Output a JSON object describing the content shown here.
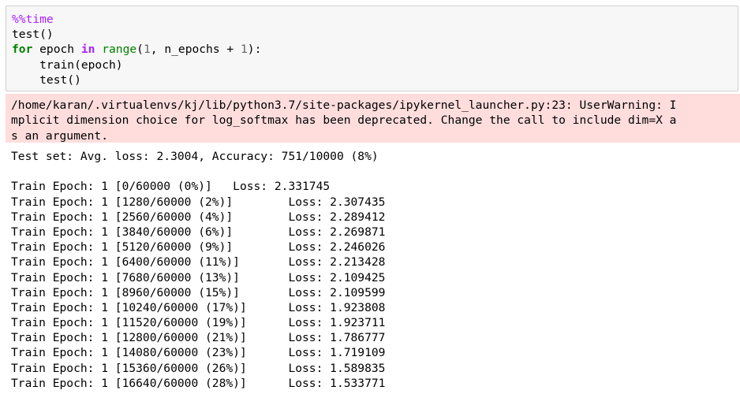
{
  "code_cell": {
    "line1_magic": "%%time",
    "line2": "test()",
    "line3_kw_for": "for",
    "line3_var": " epoch ",
    "line3_kw_in": "in",
    "line3_builtin": " range",
    "line3_open": "(",
    "line3_num1": "1",
    "line3_mid": ", n_epochs + ",
    "line3_num2": "1",
    "line3_close": "):",
    "line4": "    train(epoch)",
    "line5": "    test()"
  },
  "stderr": {
    "lines": [
      "/home/karan/.virtualenvs/kj/lib/python3.7/site-packages/ipykernel_launcher.py:23: UserWarning: I",
      "mplicit dimension choice for log_softmax has been deprecated. Change the call to include dim=X a",
      "s an argument."
    ]
  },
  "stdout": {
    "lines": [
      "Test set: Avg. loss: 2.3004, Accuracy: 751/10000 (8%)",
      "",
      "Train Epoch: 1 [0/60000 (0%)]\tLoss: 2.331745",
      "Train Epoch: 1 [1280/60000 (2%)]\tLoss: 2.307435",
      "Train Epoch: 1 [2560/60000 (4%)]\tLoss: 2.289412",
      "Train Epoch: 1 [3840/60000 (6%)]\tLoss: 2.269871",
      "Train Epoch: 1 [5120/60000 (9%)]\tLoss: 2.246026",
      "Train Epoch: 1 [6400/60000 (11%)]\tLoss: 2.213428",
      "Train Epoch: 1 [7680/60000 (13%)]\tLoss: 2.109425",
      "Train Epoch: 1 [8960/60000 (15%)]\tLoss: 2.109599",
      "Train Epoch: 1 [10240/60000 (17%)]\tLoss: 1.923808",
      "Train Epoch: 1 [11520/60000 (19%)]\tLoss: 1.923711",
      "Train Epoch: 1 [12800/60000 (21%)]\tLoss: 1.786777",
      "Train Epoch: 1 [14080/60000 (23%)]\tLoss: 1.719109",
      "Train Epoch: 1 [15360/60000 (26%)]\tLoss: 1.589835",
      "Train Epoch: 1 [16640/60000 (28%)]\tLoss: 1.533771"
    ]
  }
}
